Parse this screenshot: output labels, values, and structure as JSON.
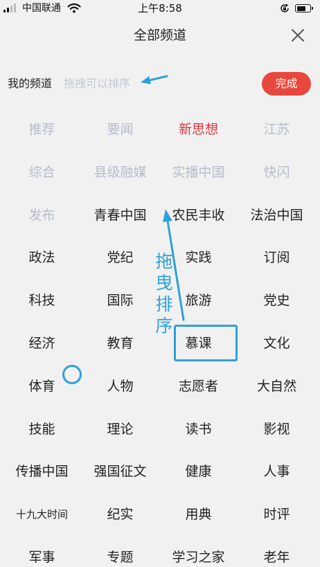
{
  "status_bar": {
    "carrier": "中国联通",
    "time": "上午8:58",
    "icons": [
      "signal-icon",
      "wifi-icon",
      "rotation-lock-icon",
      "battery-icon"
    ]
  },
  "header": {
    "title": "全部频道",
    "close_icon": "close-icon"
  },
  "my_channels": {
    "label": "我的频道",
    "hint": "拖拽可以排序",
    "done_label": "完成"
  },
  "channels": [
    {
      "label": "推荐",
      "state": "fixed"
    },
    {
      "label": "要闻",
      "state": "fixed"
    },
    {
      "label": "新思想",
      "state": "active"
    },
    {
      "label": "江苏",
      "state": "fixed"
    },
    {
      "label": "综合",
      "state": "fixed"
    },
    {
      "label": "县级融媒",
      "state": "fixed"
    },
    {
      "label": "实播中国",
      "state": "fixed"
    },
    {
      "label": "快闪",
      "state": "fixed"
    },
    {
      "label": "发布",
      "state": "fixed"
    },
    {
      "label": "青春中国",
      "state": "normal"
    },
    {
      "label": "农民丰收",
      "state": "normal"
    },
    {
      "label": "法治中国",
      "state": "normal"
    },
    {
      "label": "政法",
      "state": "normal"
    },
    {
      "label": "党纪",
      "state": "normal"
    },
    {
      "label": "实践",
      "state": "normal"
    },
    {
      "label": "订阅",
      "state": "normal"
    },
    {
      "label": "科技",
      "state": "normal"
    },
    {
      "label": "国际",
      "state": "normal"
    },
    {
      "label": "旅游",
      "state": "normal"
    },
    {
      "label": "党史",
      "state": "normal"
    },
    {
      "label": "经济",
      "state": "normal"
    },
    {
      "label": "教育",
      "state": "normal"
    },
    {
      "label": "慕课",
      "state": "normal"
    },
    {
      "label": "文化",
      "state": "normal"
    },
    {
      "label": "体育",
      "state": "normal"
    },
    {
      "label": "人物",
      "state": "normal"
    },
    {
      "label": "志愿者",
      "state": "normal"
    },
    {
      "label": "大自然",
      "state": "normal"
    },
    {
      "label": "技能",
      "state": "normal"
    },
    {
      "label": "理论",
      "state": "normal"
    },
    {
      "label": "读书",
      "state": "normal"
    },
    {
      "label": "影视",
      "state": "normal"
    },
    {
      "label": "传播中国",
      "state": "normal"
    },
    {
      "label": "强国征文",
      "state": "normal"
    },
    {
      "label": "健康",
      "state": "normal"
    },
    {
      "label": "人事",
      "state": "normal"
    },
    {
      "label": "十九大时间",
      "state": "normal"
    },
    {
      "label": "纪实",
      "state": "normal"
    },
    {
      "label": "用典",
      "state": "normal"
    },
    {
      "label": "时评",
      "state": "normal"
    },
    {
      "label": "军事",
      "state": "normal"
    },
    {
      "label": "专题",
      "state": "normal"
    },
    {
      "label": "学习之家",
      "state": "normal"
    },
    {
      "label": "老年",
      "state": "normal"
    }
  ],
  "annotations": {
    "drag_label": "拖曳排序"
  },
  "colors": {
    "background": "#f1f1f1",
    "fixed_text": "#b7bccb",
    "active_text": "#d9383e",
    "normal_text": "#222222",
    "done_button": "#e8473d",
    "hint_text": "#c3c8d6",
    "annotation": "#2ea0d8"
  }
}
